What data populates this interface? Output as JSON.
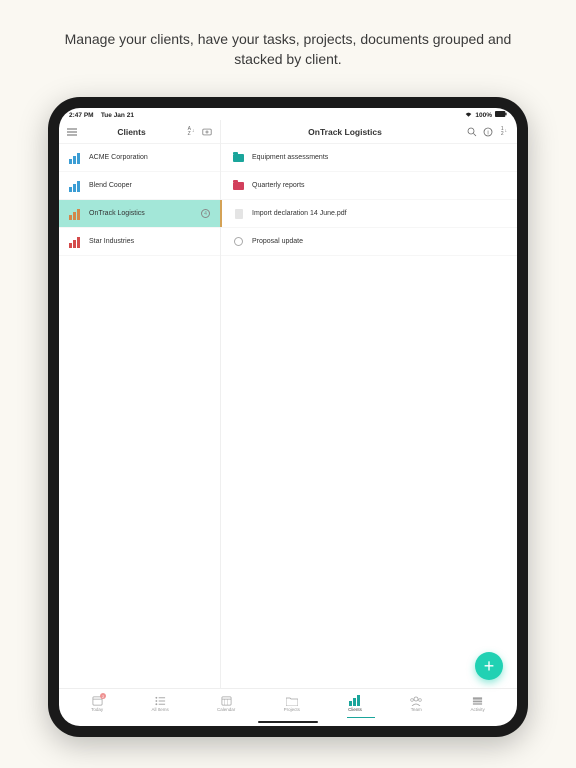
{
  "marketing": {
    "headline": "Manage your clients, have your tasks, projects, documents grouped and stacked by client."
  },
  "status": {
    "time": "2:47 PM",
    "date": "Tue Jan 21",
    "battery": "100%"
  },
  "leftPane": {
    "title": "Clients"
  },
  "clients": [
    {
      "name": "ACME Corporation",
      "color": "blue",
      "badge": ""
    },
    {
      "name": "Blend Cooper",
      "color": "blue",
      "badge": ""
    },
    {
      "name": "OnTrack Logistics",
      "color": "orange",
      "badge": "4",
      "selected": true
    },
    {
      "name": "Star Industries",
      "color": "red",
      "badge": ""
    }
  ],
  "rightPane": {
    "title": "OnTrack Logistics"
  },
  "details": [
    {
      "name": "Equipment assessments",
      "type": "folder-teal"
    },
    {
      "name": "Quarterly reports",
      "type": "folder-red"
    },
    {
      "name": "Import declaration 14 June.pdf",
      "type": "doc"
    },
    {
      "name": "Proposal update",
      "type": "task"
    }
  ],
  "nav": {
    "today": "Today",
    "allitems": "All Items",
    "calendar": "Calendar",
    "projects": "Projects",
    "clients": "Clients",
    "team": "Team",
    "activity": "Activity",
    "today_count": "2"
  },
  "fab": "+"
}
